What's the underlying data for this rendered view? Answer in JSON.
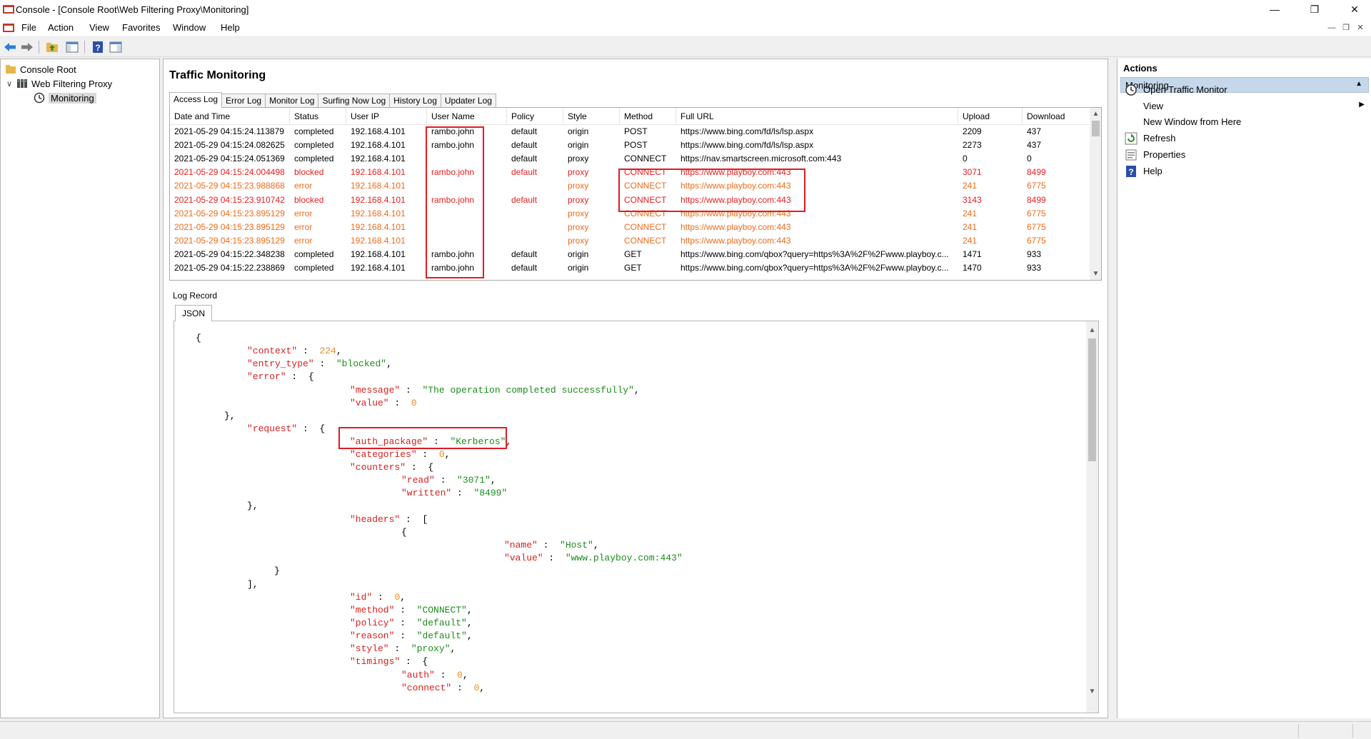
{
  "window": {
    "title": "Console - [Console Root\\Web Filtering Proxy\\Monitoring]"
  },
  "menu": [
    "File",
    "Action",
    "View",
    "Favorites",
    "Window",
    "Help"
  ],
  "toolbar": {
    "icons": [
      "back-arrow-icon",
      "forward-arrow-icon",
      "up-folder-icon",
      "show-hide-tree-icon",
      "help-icon",
      "action-pane-icon"
    ]
  },
  "tree": {
    "root": "Console Root",
    "child": "Web Filtering Proxy",
    "grandchild": "Monitoring"
  },
  "center": {
    "title": "Traffic Monitoring",
    "tabs": [
      "Access Log",
      "Error Log",
      "Monitor Log",
      "Surfing Now Log",
      "History Log",
      "Updater Log"
    ],
    "active_tab": "Access Log",
    "columns": [
      "Date and Time",
      "Status",
      "User IP",
      "User Name",
      "Policy",
      "Style",
      "Method",
      "Full URL",
      "Upload",
      "Download"
    ],
    "rows": [
      {
        "datetime": "2021-05-29 04:15:24.113879",
        "status": "completed",
        "ip": "192.168.4.101",
        "user": "rambo.john",
        "policy": "default",
        "style": "origin",
        "method": "POST",
        "url": "https://www.bing.com/fd/ls/lsp.aspx",
        "upload": "2209",
        "download": "437",
        "kind": "normal"
      },
      {
        "datetime": "2021-05-29 04:15:24.082625",
        "status": "completed",
        "ip": "192.168.4.101",
        "user": "rambo.john",
        "policy": "default",
        "style": "origin",
        "method": "POST",
        "url": "https://www.bing.com/fd/ls/lsp.aspx",
        "upload": "2273",
        "download": "437",
        "kind": "normal"
      },
      {
        "datetime": "2021-05-29 04:15:24.051369",
        "status": "completed",
        "ip": "192.168.4.101",
        "user": "",
        "policy": "default",
        "style": "proxy",
        "method": "CONNECT",
        "url": "https://nav.smartscreen.microsoft.com:443",
        "upload": "0",
        "download": "0",
        "kind": "normal"
      },
      {
        "datetime": "2021-05-29 04:15:24.004498",
        "status": "blocked",
        "ip": "192.168.4.101",
        "user": "rambo.john",
        "policy": "default",
        "style": "proxy",
        "method": "CONNECT",
        "url": "https://www.playboy.com:443",
        "upload": "3071",
        "download": "8499",
        "kind": "blocked"
      },
      {
        "datetime": "2021-05-29 04:15:23.988868",
        "status": "error",
        "ip": "192.168.4.101",
        "user": "",
        "policy": "",
        "style": "proxy",
        "method": "CONNECT",
        "url": "https://www.playboy.com:443",
        "upload": "241",
        "download": "6775",
        "kind": "error"
      },
      {
        "datetime": "2021-05-29 04:15:23.910742",
        "status": "blocked",
        "ip": "192.168.4.101",
        "user": "rambo.john",
        "policy": "default",
        "style": "proxy",
        "method": "CONNECT",
        "url": "https://www.playboy.com:443",
        "upload": "3143",
        "download": "8499",
        "kind": "blocked"
      },
      {
        "datetime": "2021-05-29 04:15:23.895129",
        "status": "error",
        "ip": "192.168.4.101",
        "user": "",
        "policy": "",
        "style": "proxy",
        "method": "CONNECT",
        "url": "https://www.playboy.com:443",
        "upload": "241",
        "download": "6775",
        "kind": "error"
      },
      {
        "datetime": "2021-05-29 04:15:23.895129",
        "status": "error",
        "ip": "192.168.4.101",
        "user": "",
        "policy": "",
        "style": "proxy",
        "method": "CONNECT",
        "url": "https://www.playboy.com:443",
        "upload": "241",
        "download": "6775",
        "kind": "error"
      },
      {
        "datetime": "2021-05-29 04:15:23.895129",
        "status": "error",
        "ip": "192.168.4.101",
        "user": "",
        "policy": "",
        "style": "proxy",
        "method": "CONNECT",
        "url": "https://www.playboy.com:443",
        "upload": "241",
        "download": "6775",
        "kind": "error"
      },
      {
        "datetime": "2021-05-29 04:15:22.348238",
        "status": "completed",
        "ip": "192.168.4.101",
        "user": "rambo.john",
        "policy": "default",
        "style": "origin",
        "method": "GET",
        "url": "https://www.bing.com/qbox?query=https%3A%2F%2Fwww.playboy.c...",
        "upload": "1471",
        "download": "933",
        "kind": "normal"
      },
      {
        "datetime": "2021-05-29 04:15:22.238869",
        "status": "completed",
        "ip": "192.168.4.101",
        "user": "rambo.john",
        "policy": "default",
        "style": "origin",
        "method": "GET",
        "url": "https://www.bing.com/qbox?query=https%3A%2F%2Fwww.playboy.c...",
        "upload": "1470",
        "download": "933",
        "kind": "normal"
      }
    ],
    "log_record_label": "Log Record",
    "json_tab": "JSON",
    "json_lines": [
      [
        [
          "p",
          "{"
        ]
      ],
      [
        [
          "k",
          "\"context\""
        ],
        [
          "p",
          " :  "
        ],
        [
          "n",
          "224"
        ],
        [
          "p",
          ","
        ]
      ],
      [
        [
          "k",
          "\"entry_type\""
        ],
        [
          "p",
          " :  "
        ],
        [
          "s",
          "\"blocked\""
        ],
        [
          "p",
          ","
        ]
      ],
      [
        [
          "k",
          "\"error\""
        ],
        [
          "p",
          " :  {"
        ]
      ],
      [
        [
          "k",
          "\"message\""
        ],
        [
          "p",
          " :  "
        ],
        [
          "s",
          "\"The operation completed successfully\""
        ],
        [
          "p",
          ","
        ]
      ],
      [
        [
          "k",
          "\"value\""
        ],
        [
          "p",
          " :  "
        ],
        [
          "n",
          "0"
        ]
      ],
      [
        [
          "p",
          "},"
        ]
      ],
      [
        [
          "k",
          "\"request\""
        ],
        [
          "p",
          " :  {"
        ]
      ],
      [
        [
          "k",
          "\"auth_package\""
        ],
        [
          "p",
          " :  "
        ],
        [
          "s",
          "\"Kerberos\""
        ],
        [
          "p",
          ","
        ]
      ],
      [
        [
          "k",
          "\"categories\""
        ],
        [
          "p",
          " :  "
        ],
        [
          "n",
          "0"
        ],
        [
          "p",
          ","
        ]
      ],
      [
        [
          "k",
          "\"counters\""
        ],
        [
          "p",
          " :  {"
        ]
      ],
      [
        [
          "k",
          "\"read\""
        ],
        [
          "p",
          " :  "
        ],
        [
          "s",
          "\"3071\""
        ],
        [
          "p",
          ","
        ]
      ],
      [
        [
          "k",
          "\"written\""
        ],
        [
          "p",
          " :  "
        ],
        [
          "s",
          "\"8499\""
        ]
      ],
      [
        [
          "p",
          "},"
        ]
      ],
      [
        [
          "k",
          "\"headers\""
        ],
        [
          "p",
          " :  ["
        ]
      ],
      [
        [
          "p",
          "{"
        ]
      ],
      [
        [
          "k",
          "\"name\""
        ],
        [
          "p",
          " :  "
        ],
        [
          "s",
          "\"Host\""
        ],
        [
          "p",
          ","
        ]
      ],
      [
        [
          "k",
          "\"value\""
        ],
        [
          "p",
          " :  "
        ],
        [
          "s",
          "\"www.playboy.com:443\""
        ]
      ],
      [
        [
          "p",
          "}"
        ]
      ],
      [
        [
          "p",
          "],"
        ]
      ],
      [
        [
          "k",
          "\"id\""
        ],
        [
          "p",
          " :  "
        ],
        [
          "n",
          "0"
        ],
        [
          "p",
          ","
        ]
      ],
      [
        [
          "k",
          "\"method\""
        ],
        [
          "p",
          " :  "
        ],
        [
          "s",
          "\"CONNECT\""
        ],
        [
          "p",
          ","
        ]
      ],
      [
        [
          "k",
          "\"policy\""
        ],
        [
          "p",
          " :  "
        ],
        [
          "s",
          "\"default\""
        ],
        [
          "p",
          ","
        ]
      ],
      [
        [
          "k",
          "\"reason\""
        ],
        [
          "p",
          " :  "
        ],
        [
          "s",
          "\"default\""
        ],
        [
          "p",
          ","
        ]
      ],
      [
        [
          "k",
          "\"style\""
        ],
        [
          "p",
          " :  "
        ],
        [
          "s",
          "\"proxy\""
        ],
        [
          "p",
          ","
        ]
      ],
      [
        [
          "k",
          "\"timings\""
        ],
        [
          "p",
          " :  {"
        ]
      ],
      [
        [
          "k",
          "\"auth\""
        ],
        [
          "p",
          " :  "
        ],
        [
          "n",
          "0"
        ],
        [
          "p",
          ","
        ]
      ],
      [
        [
          "k",
          "\"connect\""
        ],
        [
          "p",
          " :  "
        ],
        [
          "n",
          "0"
        ],
        [
          "p",
          ","
        ]
      ]
    ]
  },
  "actions": {
    "title": "Actions",
    "section": "Monitoring",
    "items": [
      {
        "label": "Open Traffic Monitor",
        "icon": "clock-icon",
        "submenu": false
      },
      {
        "label": "View",
        "icon": "",
        "submenu": true
      },
      {
        "label": "New Window from Here",
        "icon": "",
        "submenu": false
      },
      {
        "label": "Refresh",
        "icon": "refresh-icon",
        "submenu": false
      },
      {
        "label": "Properties",
        "icon": "properties-icon",
        "submenu": false
      },
      {
        "label": "Help",
        "icon": "help-icon",
        "submenu": false
      }
    ]
  },
  "colors": {
    "blocked": "#e61e1e",
    "error": "#ef6a1a",
    "highlight_box": "#e01b24",
    "json_key": "#d92020",
    "json_string": "#1d8c1d",
    "json_number": "#f08a24",
    "actions_header": "#c5d7ea"
  }
}
